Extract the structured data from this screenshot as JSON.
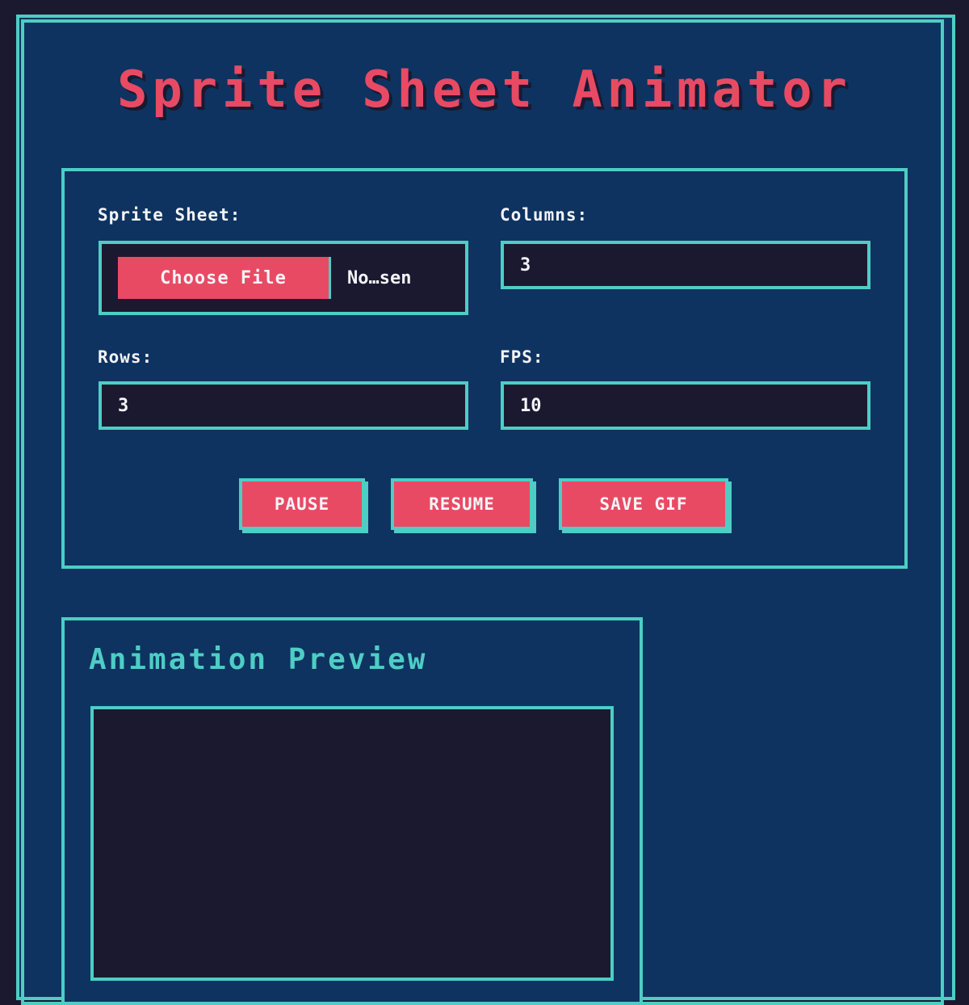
{
  "app": {
    "title": "Sprite Sheet Animator"
  },
  "controls": {
    "sprite_sheet_label": "Sprite Sheet:",
    "choose_file_label": "Choose File",
    "file_name": "No…sen",
    "columns_label": "Columns:",
    "columns_value": "3",
    "rows_label": "Rows:",
    "rows_value": "3",
    "fps_label": "FPS:",
    "fps_value": "10"
  },
  "buttons": {
    "pause": "PAUSE",
    "resume": "RESUME",
    "save_gif": "SAVE GIF"
  },
  "preview": {
    "title": "Animation Preview"
  },
  "colors": {
    "background": "#1b1930",
    "panel": "#0e3360",
    "accent": "#4ecdc4",
    "primary": "#e84a64",
    "text": "#f4f4f8"
  }
}
